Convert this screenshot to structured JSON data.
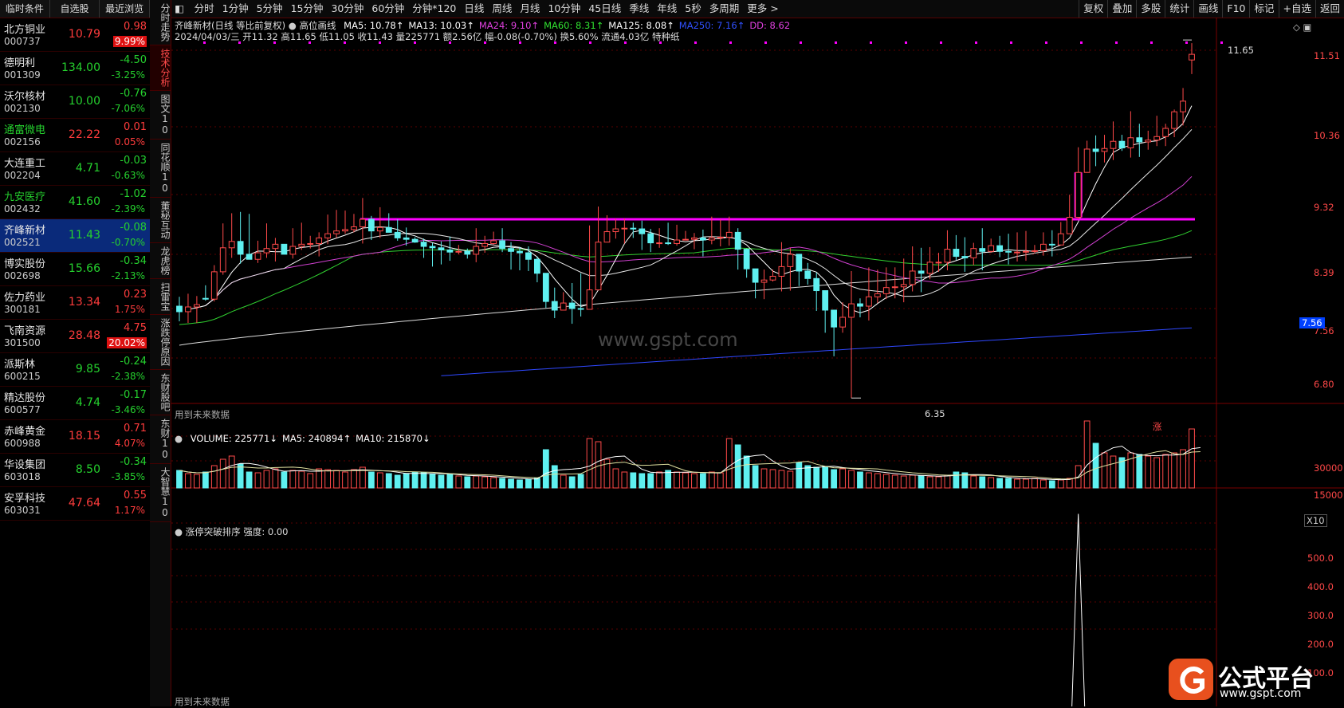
{
  "left_panel": {
    "tabs": [
      "临时条件",
      "自选股",
      "最近浏览"
    ],
    "stocks": [
      {
        "name": "北方铜业",
        "code": "000737",
        "price": "10.79",
        "change": "0.98",
        "pct": "9.99%",
        "dir": "up",
        "pct_box": true
      },
      {
        "name": "德明利",
        "code": "001309",
        "price": "134.00",
        "change": "-4.50",
        "pct": "-3.25%",
        "dir": "dn"
      },
      {
        "name": "沃尔核材",
        "code": "002130",
        "price": "10.00",
        "change": "-0.76",
        "pct": "-7.06%",
        "dir": "dn"
      },
      {
        "name": "通富微电",
        "code": "002156",
        "price": "22.22",
        "change": "0.01",
        "pct": "0.05%",
        "dir": "up",
        "name_green": true
      },
      {
        "name": "大连重工",
        "code": "002204",
        "price": "4.71",
        "change": "-0.03",
        "pct": "-0.63%",
        "dir": "dn"
      },
      {
        "name": "九安医疗",
        "code": "002432",
        "price": "41.60",
        "change": "-1.02",
        "pct": "-2.39%",
        "dir": "dn",
        "name_green": true
      },
      {
        "name": "齐峰新材",
        "code": "002521",
        "price": "11.43",
        "change": "-0.08",
        "pct": "-0.70%",
        "dir": "dn",
        "selected": true
      },
      {
        "name": "博实股份",
        "code": "002698",
        "price": "15.66",
        "change": "-0.34",
        "pct": "-2.13%",
        "dir": "dn"
      },
      {
        "name": "佐力药业",
        "code": "300181",
        "price": "13.34",
        "change": "0.23",
        "pct": "1.75%",
        "dir": "up"
      },
      {
        "name": "飞南资源",
        "code": "301500",
        "price": "28.48",
        "change": "4.75",
        "pct": "20.02%",
        "dir": "up",
        "pct_box": true
      },
      {
        "name": "派斯林",
        "code": "600215",
        "price": "9.85",
        "change": "-0.24",
        "pct": "-2.38%",
        "dir": "dn"
      },
      {
        "name": "精达股份",
        "code": "600577",
        "price": "4.74",
        "change": "-0.17",
        "pct": "-3.46%",
        "dir": "dn"
      },
      {
        "name": "赤峰黄金",
        "code": "600988",
        "price": "18.15",
        "change": "0.71",
        "pct": "4.07%",
        "dir": "up"
      },
      {
        "name": "华设集团",
        "code": "603018",
        "price": "8.50",
        "change": "-0.34",
        "pct": "-3.85%",
        "dir": "dn"
      },
      {
        "name": "安孚科技",
        "code": "603031",
        "price": "47.64",
        "change": "0.55",
        "pct": "1.17%",
        "dir": "up"
      }
    ]
  },
  "vertical_tabs": [
    "分时走势",
    "技术分析",
    "图文10",
    "同花顺10",
    "董秘互动",
    "龙虎榜",
    "扫雷宝",
    "涨跌停原因",
    "东财股吧",
    "东财10",
    "大智慧10"
  ],
  "toolbar": {
    "periods": [
      "分时",
      "1分钟",
      "5分钟",
      "15分钟",
      "30分钟",
      "60分钟",
      "分钟*120",
      "日线",
      "周线",
      "月线",
      "10分钟",
      "45日线",
      "季线",
      "年线",
      "5秒",
      "多周期",
      "更多 >"
    ],
    "right_items": [
      "复权",
      "叠加",
      "多股",
      "统计",
      "画线",
      "F10",
      "标记",
      "+自选",
      "返回"
    ]
  },
  "price_panel": {
    "title": "齐峰新材(日线 等比前复权)",
    "indicator": "高位画线",
    "ma_labels": [
      {
        "text": "MA5: 10.78↑",
        "color": "#ffffff"
      },
      {
        "text": "MA13: 10.03↑",
        "color": "#ffffff"
      },
      {
        "text": "MA24: 9.10↑",
        "color": "#e040e0"
      },
      {
        "text": "MA60: 8.31↑",
        "color": "#30e030"
      },
      {
        "text": "MA125: 8.08↑",
        "color": "#ffffff"
      },
      {
        "text": "MA250: 7.16↑",
        "color": "#3050ff"
      },
      {
        "text": "DD: 8.62",
        "color": "#e040e0"
      }
    ],
    "info_line": "2024/04/03/三 开11.32 高11.65 低11.05 收11.43 量225771 额2.56亿 幅-0.08(-0.70%) 换5.60% 流通4.03亿 特种纸",
    "y_ticks": [
      "11.51",
      "10.36",
      "9.32",
      "8.39",
      "7.56",
      "6.80"
    ],
    "current_price_badge": "7.56",
    "high_label": "11.65",
    "low_label": "6.35",
    "future_data_note": "用到未来数据",
    "watermark": "www.gspt.com",
    "limit_up_mark": "涨",
    "resistance_level": 8.62,
    "chart_data": {
      "type": "candlestick",
      "closes": [
        7.36,
        7.42,
        7.45,
        7.52,
        7.88,
        8.21,
        8.3,
        8.12,
        8.05,
        8.14,
        8.2,
        8.26,
        8.12,
        8.23,
        8.26,
        8.27,
        8.35,
        8.41,
        8.45,
        8.47,
        8.51,
        8.62,
        8.45,
        8.5,
        8.43,
        8.35,
        8.33,
        8.29,
        8.23,
        8.21,
        8.18,
        8.15,
        8.16,
        8.12,
        8.23,
        8.27,
        8.31,
        8.2,
        8.16,
        8.14,
        8.05,
        7.86,
        7.49,
        7.38,
        7.47,
        7.4,
        7.39,
        7.64,
        8.29,
        8.44,
        8.48,
        8.49,
        8.48,
        8.41,
        8.28,
        8.28,
        8.27,
        8.32,
        8.33,
        8.35,
        8.32,
        8.35,
        8.36,
        8.43,
        8.19,
        7.92,
        7.74,
        7.77,
        7.82,
        7.95,
        8.12,
        7.89,
        7.79,
        7.63,
        7.38,
        7.17,
        7.29,
        7.46,
        7.43,
        7.55,
        7.59,
        7.67,
        7.68,
        7.71,
        7.89,
        7.86,
        8.01,
        8.01,
        8.19,
        8.09,
        8.07,
        8.2,
        8.16,
        8.24,
        8.16,
        8.15,
        8.15,
        8.16,
        8.17,
        8.26,
        8.25,
        8.41,
        8.65,
        9.34,
        9.72,
        9.68,
        9.73,
        9.85,
        9.74,
        9.91,
        9.84,
        9.87,
        9.93,
        10.07,
        10.36,
        10.55,
        11.43
      ],
      "highs": [
        7.55,
        7.59,
        7.56,
        7.7,
        7.97,
        8.56,
        8.71,
        8.73,
        8.7,
        8.31,
        8.56,
        8.35,
        8.21,
        8.49,
        8.57,
        8.38,
        8.43,
        8.69,
        8.76,
        8.75,
        8.7,
        8.94,
        8.67,
        8.8,
        8.71,
        8.62,
        8.5,
        8.36,
        8.34,
        8.28,
        8.3,
        8.37,
        8.25,
        8.2,
        8.49,
        8.38,
        8.44,
        8.49,
        8.29,
        8.22,
        8.23,
        8.09,
        7.66,
        7.67,
        7.61,
        7.73,
        7.86,
        8.53,
        8.81,
        8.68,
        8.63,
        8.63,
        8.57,
        8.6,
        8.48,
        8.49,
        8.57,
        8.54,
        8.45,
        8.42,
        8.47,
        8.66,
        8.62,
        8.66,
        8.49,
        8.2,
        7.86,
        7.91,
        7.91,
        8.29,
        8.21,
        8.06,
        8.0,
        7.87,
        7.46,
        7.33,
        7.48,
        7.89,
        7.53,
        7.94,
        7.91,
        7.94,
        7.94,
        8.06,
        8.23,
        8.21,
        8.22,
        8.14,
        8.46,
        8.39,
        8.36,
        8.28,
        8.49,
        8.34,
        8.38,
        8.41,
        8.43,
        8.45,
        8.25,
        8.43,
        8.46,
        8.58,
        8.99,
        9.75,
        9.86,
        9.95,
        9.96,
        10.19,
        9.96,
        10.37,
        10.15,
        10.03,
        10.29,
        10.15,
        10.4,
        10.79,
        11.65
      ],
      "lows": [
        7.24,
        7.22,
        7.22,
        7.5,
        7.49,
        7.84,
        8.07,
        7.99,
        8.05,
        8.0,
        8.07,
        8.02,
        8.12,
        8.06,
        8.18,
        8.2,
        8.09,
        8.26,
        8.35,
        8.41,
        8.43,
        8.27,
        8.32,
        8.35,
        8.43,
        8.31,
        8.24,
        8.28,
        8.07,
        7.95,
        7.98,
        8.03,
        8.12,
        8.06,
        8.01,
        8.14,
        8.25,
        8.15,
        7.91,
        7.9,
        7.89,
        7.74,
        7.41,
        7.28,
        7.38,
        7.21,
        7.3,
        7.39,
        8.13,
        8.32,
        8.34,
        8.27,
        8.35,
        8.18,
        8.15,
        8.21,
        8.25,
        8.24,
        8.32,
        8.19,
        8.09,
        8.26,
        8.23,
        8.24,
        7.91,
        7.8,
        7.53,
        7.52,
        7.75,
        7.62,
        7.63,
        7.69,
        7.71,
        7.37,
        7.1,
        6.82,
        7.1,
        6.35,
        7.29,
        7.25,
        7.47,
        7.52,
        7.53,
        7.48,
        7.62,
        7.61,
        7.78,
        7.88,
        7.9,
        8.04,
        7.88,
        7.97,
        7.9,
        8.14,
        8.08,
        7.98,
        8.02,
        8.03,
        8.13,
        8.1,
        8.09,
        8.31,
        8.49,
        8.62,
        9.42,
        9.44,
        9.5,
        9.54,
        9.69,
        9.58,
        9.59,
        9.71,
        9.77,
        9.77,
        9.92,
        10.12,
        11.05
      ],
      "opens": [
        7.43,
        7.36,
        7.42,
        7.53,
        7.52,
        7.88,
        8.21,
        8.3,
        8.12,
        8.05,
        8.14,
        8.2,
        8.26,
        8.12,
        8.23,
        8.26,
        8.27,
        8.35,
        8.41,
        8.45,
        8.47,
        8.51,
        8.62,
        8.45,
        8.5,
        8.43,
        8.35,
        8.33,
        8.29,
        8.23,
        8.21,
        8.18,
        8.15,
        8.16,
        8.12,
        8.23,
        8.27,
        8.31,
        8.2,
        8.16,
        8.14,
        8.05,
        7.86,
        7.49,
        7.38,
        7.47,
        7.4,
        7.39,
        7.64,
        8.29,
        8.44,
        8.48,
        8.49,
        8.48,
        8.41,
        8.28,
        8.28,
        8.27,
        8.32,
        8.33,
        8.35,
        8.32,
        8.35,
        8.36,
        8.43,
        8.19,
        7.92,
        7.74,
        7.77,
        7.82,
        7.95,
        8.12,
        7.89,
        7.79,
        7.63,
        7.38,
        7.17,
        7.29,
        7.46,
        7.43,
        7.55,
        7.59,
        7.67,
        7.68,
        7.71,
        7.89,
        7.86,
        8.01,
        8.01,
        8.19,
        8.09,
        8.07,
        8.2,
        8.16,
        8.24,
        8.16,
        8.15,
        8.15,
        8.16,
        8.17,
        8.26,
        8.25,
        8.41,
        8.65,
        9.34,
        9.72,
        9.68,
        9.73,
        9.85,
        9.74,
        9.91,
        9.84,
        9.87,
        9.93,
        10.07,
        10.36,
        11.32
      ],
      "ma5_last": 10.78,
      "ma13_last": 10.03,
      "ma24_last": 9.1,
      "ma60_last": 8.31,
      "ma125_last": 8.08,
      "ma250_last": 7.16
    }
  },
  "volume_panel": {
    "labels": [
      {
        "text": "VOLUME: 225771↓",
        "color": "#ffffff"
      },
      {
        "text": "MA5: 240894↑",
        "color": "#ffffff"
      },
      {
        "text": "MA10: 215870↓",
        "color": "#ffffff"
      }
    ],
    "y_ticks": [
      "30000",
      "15000"
    ],
    "unit": "X10",
    "chart_data": {
      "type": "bar",
      "values": [
        11000,
        9000,
        8500,
        10000,
        14000,
        18000,
        20000,
        15000,
        10000,
        9500,
        11000,
        12000,
        10000,
        11000,
        10500,
        9000,
        12000,
        11500,
        11000,
        10000,
        11500,
        13000,
        10000,
        9500,
        9000,
        8000,
        9000,
        10000,
        9500,
        8500,
        8000,
        8500,
        7500,
        7000,
        7500,
        7000,
        6500,
        6000,
        5500,
        5000,
        5500,
        6000,
        24000,
        14000,
        8000,
        7000,
        8500,
        31000,
        29000,
        18000,
        12000,
        10000,
        9500,
        9000,
        9000,
        10000,
        11000,
        10000,
        9500,
        9000,
        9000,
        10000,
        9500,
        31000,
        27000,
        20000,
        14000,
        12000,
        11500,
        11000,
        10500,
        16000,
        14000,
        13000,
        13500,
        11500,
        12000,
        11000,
        10000,
        9500,
        9000,
        8500,
        8000,
        7500,
        8000,
        7500,
        7000,
        7000,
        8000,
        10000,
        9500,
        7500,
        7000,
        6500,
        6000,
        6000,
        5500,
        5500,
        6000,
        5000,
        4500,
        5000,
        6000,
        14000,
        42000,
        28000,
        22000,
        20000,
        19000,
        22000,
        21000,
        20000,
        19000,
        21000,
        22000,
        24000,
        37000,
        22500
      ],
      "colors": "cyan for down days, red outline for up days"
    }
  },
  "indicator_panel": {
    "label": "涨停突破排序",
    "strength": "强度: 0.00",
    "y_ticks": [
      "500.0",
      "400.0",
      "300.0",
      "200.0",
      "100.0"
    ],
    "future_data_note": "用到未来数据",
    "chart_data": {
      "type": "line",
      "spike_index": 113,
      "spike_value": 580,
      "baseline": 0
    }
  },
  "branding": {
    "logo_cn": "公式平台",
    "logo_url": "www.gspt.com"
  },
  "colors": {
    "up": "#ff3c3c",
    "down": "#25d12e",
    "cyan": "#5ff0f0",
    "magenta": "#ff00ff",
    "grid_red": "#5a0000"
  }
}
